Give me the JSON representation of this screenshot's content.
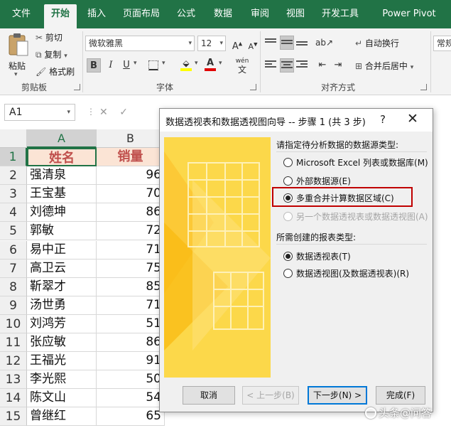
{
  "ribbon_tabs": [
    "文件",
    "开始",
    "插入",
    "页面布局",
    "公式",
    "数据",
    "审阅",
    "视图",
    "开发工具",
    "Power Pivot"
  ],
  "clipboard": {
    "paste": "粘贴",
    "cut": "剪切",
    "copy": "复制",
    "format_painter": "格式刷",
    "group_label": "剪贴板"
  },
  "font": {
    "name": "微软雅黑",
    "size": "12",
    "group_label": "字体",
    "bold": "B",
    "italic": "I",
    "underline": "U",
    "phonetic": "wén"
  },
  "alignment": {
    "wrap_text": "自动换行",
    "merge_center": "合并后居中",
    "group_label": "对齐方式"
  },
  "number": {
    "format": "常规"
  },
  "formula_bar": {
    "name_box": "A1"
  },
  "sheet": {
    "columns": [
      "A",
      "B"
    ],
    "rows": [
      "1",
      "2",
      "3",
      "4",
      "5",
      "6",
      "7",
      "8",
      "9",
      "10",
      "11",
      "12",
      "13",
      "14",
      "15"
    ],
    "header": {
      "name": "姓名",
      "sales": "销量"
    },
    "data": [
      {
        "name": "强清泉",
        "sales": "96"
      },
      {
        "name": "王宝基",
        "sales": "70"
      },
      {
        "name": "刘德坤",
        "sales": "86"
      },
      {
        "name": "郭敏",
        "sales": "72"
      },
      {
        "name": "易中正",
        "sales": "71"
      },
      {
        "name": "高卫云",
        "sales": "75"
      },
      {
        "name": "靳翠才",
        "sales": "85"
      },
      {
        "name": "汤世勇",
        "sales": "71"
      },
      {
        "name": "刘鸿芳",
        "sales": "51"
      },
      {
        "name": "张应敏",
        "sales": "86"
      },
      {
        "name": "王福光",
        "sales": "91"
      },
      {
        "name": "李光熙",
        "sales": "50"
      },
      {
        "name": "陈文山",
        "sales": "54"
      },
      {
        "name": "曾继红",
        "sales": "65"
      }
    ]
  },
  "dialog": {
    "title": "数据透视表和数据透视图向导 -- 步骤 1 (共 3 步)",
    "help": "?",
    "close": "✕",
    "source_prompt": "请指定待分析数据的数据源类型:",
    "source_options": [
      {
        "label": "Microsoft Excel 列表或数据库(M)",
        "checked": false,
        "disabled": false
      },
      {
        "label": "外部数据源(E)",
        "checked": false,
        "disabled": false
      },
      {
        "label": "多重合并计算数据区域(C)",
        "checked": true,
        "disabled": false
      },
      {
        "label": "另一个数据透视表或数据透视图(A)",
        "checked": false,
        "disabled": true
      }
    ],
    "report_prompt": "所需创建的报表类型:",
    "report_options": [
      {
        "label": "数据透视表(T)",
        "checked": true
      },
      {
        "label": "数据透视图(及数据透视表)(R)",
        "checked": false
      }
    ],
    "buttons": {
      "cancel": "取消",
      "back": "< 上一步(B)",
      "next": "下一步(N) >",
      "finish": "完成(F)"
    }
  },
  "watermark": "头条@问答",
  "colors": {
    "excel_green": "#217346",
    "highlight_red": "#c00000",
    "header_fill": "#fbe4d5",
    "header_text": "#c0504d",
    "wizard_art": "#fcd84a"
  }
}
